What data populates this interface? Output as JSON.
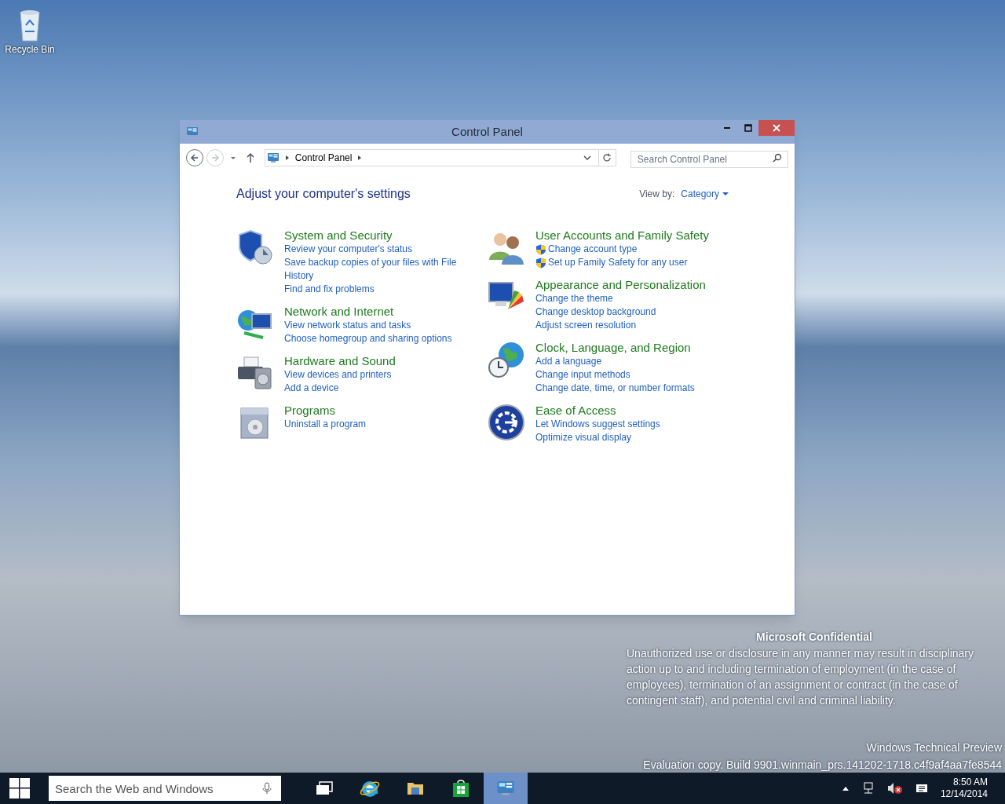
{
  "desktop": {
    "icons": [
      {
        "label": "Recycle Bin"
      }
    ],
    "notice": {
      "title": "Microsoft Confidential",
      "body": "Unauthorized use or disclosure in any manner may result in disciplinary action up to and including termination of employment (in the case of employees), termination of an assignment or contract (in the case of contingent staff), and potential civil and criminal liability."
    },
    "edition": "Windows Technical Preview",
    "build": "Evaluation copy. Build 9901.winmain_prs.141202-1718.c4f9af4aa7fe8544"
  },
  "window": {
    "title": "Control Panel",
    "address": {
      "crumbs": [
        "Control Panel"
      ]
    },
    "search": {
      "placeholder": "Search Control Panel"
    },
    "heading": "Adjust your computer's settings",
    "view_by": {
      "label": "View by:",
      "value": "Category"
    },
    "columns": [
      [
        {
          "kind": "security",
          "title": "System and Security",
          "links": [
            {
              "text": "Review your computer's status",
              "shield": false
            },
            {
              "text": "Save backup copies of your files with File History",
              "shield": false
            },
            {
              "text": "Find and fix problems",
              "shield": false
            }
          ]
        },
        {
          "kind": "network",
          "title": "Network and Internet",
          "links": [
            {
              "text": "View network status and tasks",
              "shield": false
            },
            {
              "text": "Choose homegroup and sharing options",
              "shield": false
            }
          ]
        },
        {
          "kind": "hardware",
          "title": "Hardware and Sound",
          "links": [
            {
              "text": "View devices and printers",
              "shield": false
            },
            {
              "text": "Add a device",
              "shield": false
            }
          ]
        },
        {
          "kind": "programs",
          "title": "Programs",
          "links": [
            {
              "text": "Uninstall a program",
              "shield": false
            }
          ]
        }
      ],
      [
        {
          "kind": "users",
          "title": "User Accounts and Family Safety",
          "links": [
            {
              "text": "Change account type",
              "shield": true
            },
            {
              "text": "Set up Family Safety for any user",
              "shield": true
            }
          ]
        },
        {
          "kind": "appearance",
          "title": "Appearance and Personalization",
          "links": [
            {
              "text": "Change the theme",
              "shield": false
            },
            {
              "text": "Change desktop background",
              "shield": false
            },
            {
              "text": "Adjust screen resolution",
              "shield": false
            }
          ]
        },
        {
          "kind": "clock",
          "title": "Clock, Language, and Region",
          "links": [
            {
              "text": "Add a language",
              "shield": false
            },
            {
              "text": "Change input methods",
              "shield": false
            },
            {
              "text": "Change date, time, or number formats",
              "shield": false
            }
          ]
        },
        {
          "kind": "access",
          "title": "Ease of Access",
          "links": [
            {
              "text": "Let Windows suggest settings",
              "shield": false
            },
            {
              "text": "Optimize visual display",
              "shield": false
            }
          ]
        }
      ]
    ]
  },
  "taskbar": {
    "search": {
      "placeholder": "Search the Web and Windows"
    },
    "apps": [
      {
        "kind": "task-view",
        "selected": false
      },
      {
        "kind": "browser",
        "selected": false
      },
      {
        "kind": "folder",
        "selected": false
      },
      {
        "kind": "store",
        "selected": false
      },
      {
        "kind": "control-panel",
        "selected": true
      }
    ],
    "clock": {
      "time": "8:50 AM",
      "date": "12/14/2014"
    }
  }
}
